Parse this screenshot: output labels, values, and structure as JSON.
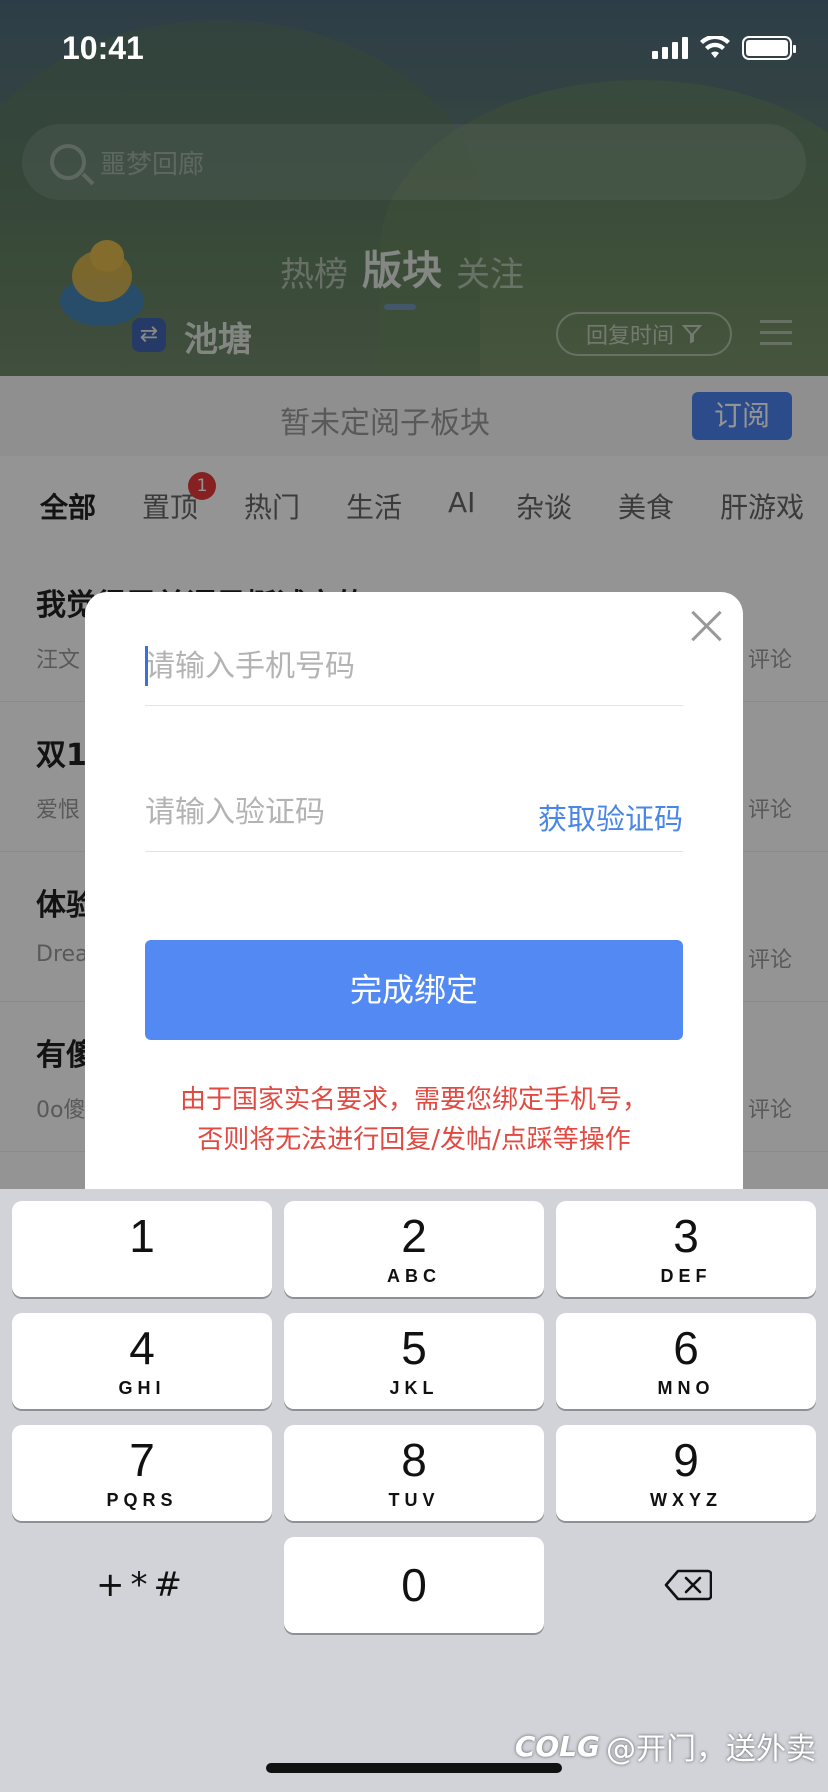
{
  "status_bar": {
    "time": "10:41"
  },
  "header": {
    "search_placeholder": "噩梦回廊",
    "tabs": [
      "热榜",
      "版块",
      "关注"
    ],
    "forum_name": "池塘",
    "sort_label": "回复时间"
  },
  "subscribe_bar": {
    "text": "暂未定阅子板块",
    "button": "订阅"
  },
  "categories": {
    "items": [
      "全部",
      "置顶",
      "热门",
      "生活",
      "AI",
      "杂谈",
      "美食",
      "肝游戏"
    ],
    "pinned_badge": "1"
  },
  "posts": [
    {
      "title": "我觉得需单语是挺诚实的",
      "meta": "汪文",
      "comments": "评论"
    },
    {
      "title": "双1",
      "meta": "爱恨",
      "comments": "评论"
    },
    {
      "title": "体验",
      "meta": "Drea",
      "comments": "评论"
    },
    {
      "title": "有傻",
      "meta": "0o傻",
      "comments": "评论"
    }
  ],
  "modal": {
    "phone_placeholder": "请输入手机号码",
    "code_placeholder": "请输入验证码",
    "get_code_label": "获取验证码",
    "submit_label": "完成绑定",
    "notice_line1": "由于国家实名要求，需要您绑定手机号，",
    "notice_line2": "否则将无法进行回复/发帖/点踩等操作"
  },
  "keyboard": {
    "keys": [
      {
        "num": "1",
        "letters": ""
      },
      {
        "num": "2",
        "letters": "ABC"
      },
      {
        "num": "3",
        "letters": "DEF"
      },
      {
        "num": "4",
        "letters": "GHI"
      },
      {
        "num": "5",
        "letters": "JKL"
      },
      {
        "num": "6",
        "letters": "MNO"
      },
      {
        "num": "7",
        "letters": "PQRS"
      },
      {
        "num": "8",
        "letters": "TUV"
      },
      {
        "num": "9",
        "letters": "WXYZ"
      },
      {
        "num": "0",
        "letters": ""
      }
    ],
    "symbols_label": "+*#",
    "delete_icon": "backspace-icon"
  },
  "watermark": {
    "logo": "COLG",
    "text": "@开门，送外卖"
  },
  "colors": {
    "accent": "#5289f2",
    "notice": "#e04a42",
    "link": "#4a86e8"
  }
}
